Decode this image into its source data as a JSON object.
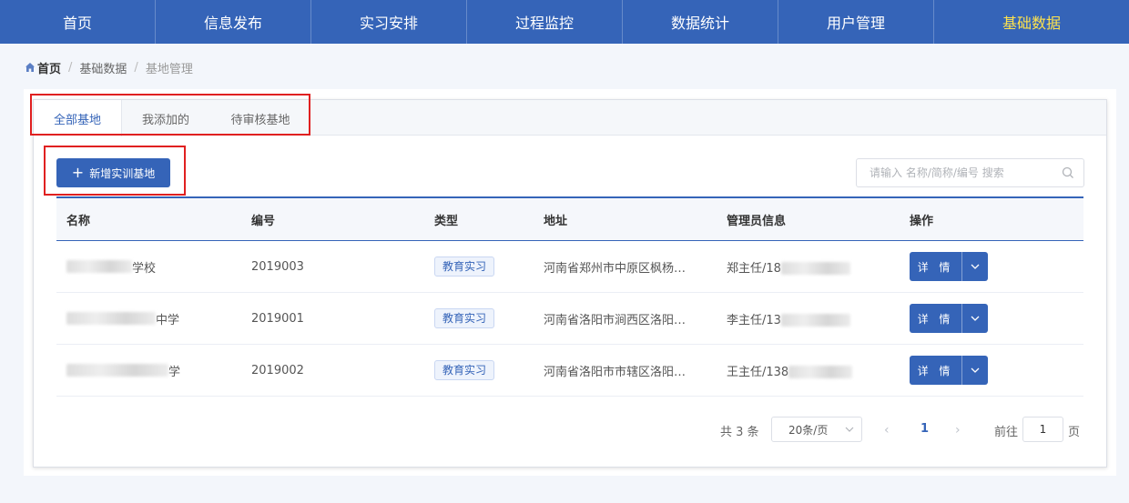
{
  "nav": {
    "items": [
      "首页",
      "信息发布",
      "实习安排",
      "过程监控",
      "数据统计",
      "用户管理",
      "基础数据"
    ],
    "active_index": 6
  },
  "breadcrumb": {
    "home": "首页",
    "level1": "基础数据",
    "level2": "基地管理"
  },
  "tabs": [
    "全部基地",
    "我添加的",
    "待审核基地"
  ],
  "toolbar": {
    "add_label": "新增实训基地",
    "search_placeholder": "请输入 名称/简称/编号 搜索"
  },
  "table": {
    "headers": [
      "名称",
      "编号",
      "类型",
      "地址",
      "管理员信息",
      "操作"
    ],
    "rows": [
      {
        "name_suffix": "学校",
        "code": "2019003",
        "type": "教育实习",
        "address": "河南省郑州市中原区枫杨…",
        "admin": "郑主任/18",
        "action": "详 情"
      },
      {
        "name_suffix": "中学",
        "code": "2019001",
        "type": "教育实习",
        "address": "河南省洛阳市涧西区洛阳…",
        "admin": "李主任/13",
        "action": "详 情"
      },
      {
        "name_suffix": "学",
        "code": "2019002",
        "type": "教育实习",
        "address": "河南省洛阳市市辖区洛阳…",
        "admin": "王主任/138",
        "action": "详 情"
      }
    ]
  },
  "pagination": {
    "total": "共 3 条",
    "page_size": "20条/页",
    "current": "1",
    "goto": "前往",
    "goto_value": "1",
    "page_unit": "页"
  },
  "colors": {
    "primary": "#3564b8",
    "nav_active": "#ffe34d",
    "highlight": "#e02020"
  }
}
